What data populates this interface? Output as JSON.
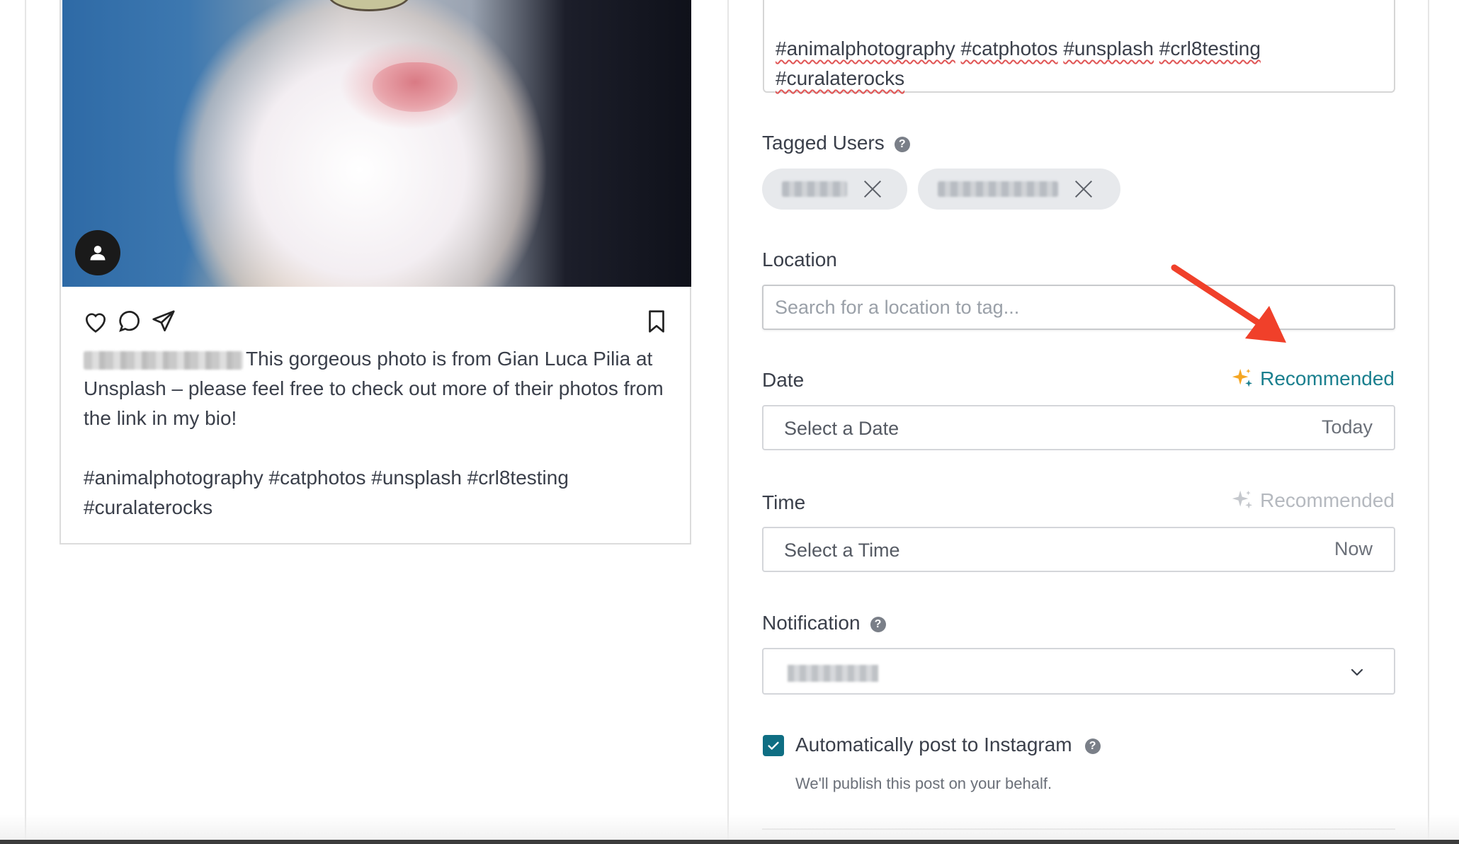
{
  "preview": {
    "caption_text": "This gorgeous photo is from Gian Luca Pilia at Unsplash – please feel free to check out more of their photos from the link in my bio!",
    "hashtags_line1": "#animalphotography #catphotos #unsplash #crl8testing",
    "hashtags_line2": "#curalaterocks"
  },
  "caption_field": {
    "hashtags": [
      "#animalphotography",
      "#catphotos",
      "#unsplash",
      "#crl8testing",
      "#curalaterocks"
    ]
  },
  "tagged_users": {
    "label": "Tagged Users"
  },
  "location": {
    "label": "Location",
    "placeholder": "Search for a location to tag..."
  },
  "date": {
    "label": "Date",
    "recommended": "Recommended",
    "placeholder": "Select a Date",
    "value": "Today"
  },
  "time": {
    "label": "Time",
    "recommended": "Recommended",
    "placeholder": "Select a Time",
    "value": "Now"
  },
  "notification": {
    "label": "Notification"
  },
  "auto_post": {
    "label": "Automatically post to Instagram",
    "checked": true,
    "subtext": "We'll publish this post on your behalf."
  },
  "colors": {
    "accent": "#0f6e83",
    "recommended_active": "#1a7f8e",
    "recommended_inactive": "#b5b9bf",
    "sparkle": "#f5a623",
    "arrow": "#f0402a"
  },
  "help_glyph": "?"
}
